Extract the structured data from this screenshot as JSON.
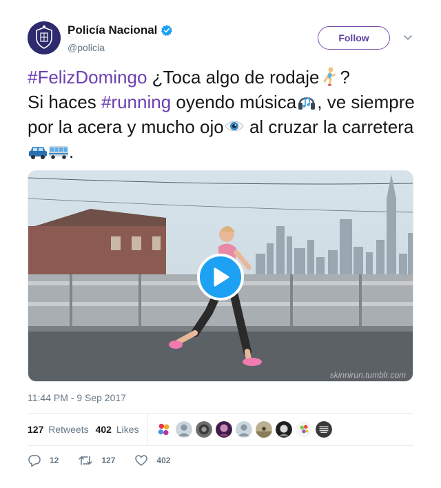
{
  "account": {
    "display_name": "Policía Nacional",
    "handle": "@policia",
    "verified": true,
    "follow_label": "Follow"
  },
  "tweet": {
    "hashtag1": "#FelizDomingo",
    "text1": " ¿Toca algo de rodaje",
    "text2": "?",
    "text3": "Si haces ",
    "hashtag2": "#running",
    "text4": " oyendo música",
    "text5": ", ve siempre por la acera y mucho ojo",
    "text6": " al cruzar la carretera",
    "text7": "."
  },
  "media": {
    "watermark": "skinnirun.tumblr.com"
  },
  "timestamp": "11:44 PM - 9 Sep 2017",
  "stats": {
    "retweets_count": "127",
    "retweets_label": "Retweets",
    "likes_count": "402",
    "likes_label": "Likes"
  },
  "actions": {
    "replies": "12",
    "retweets": "127",
    "likes": "402"
  },
  "colors": {
    "accent": "#6c3fb0",
    "play": "#1da1f2"
  }
}
